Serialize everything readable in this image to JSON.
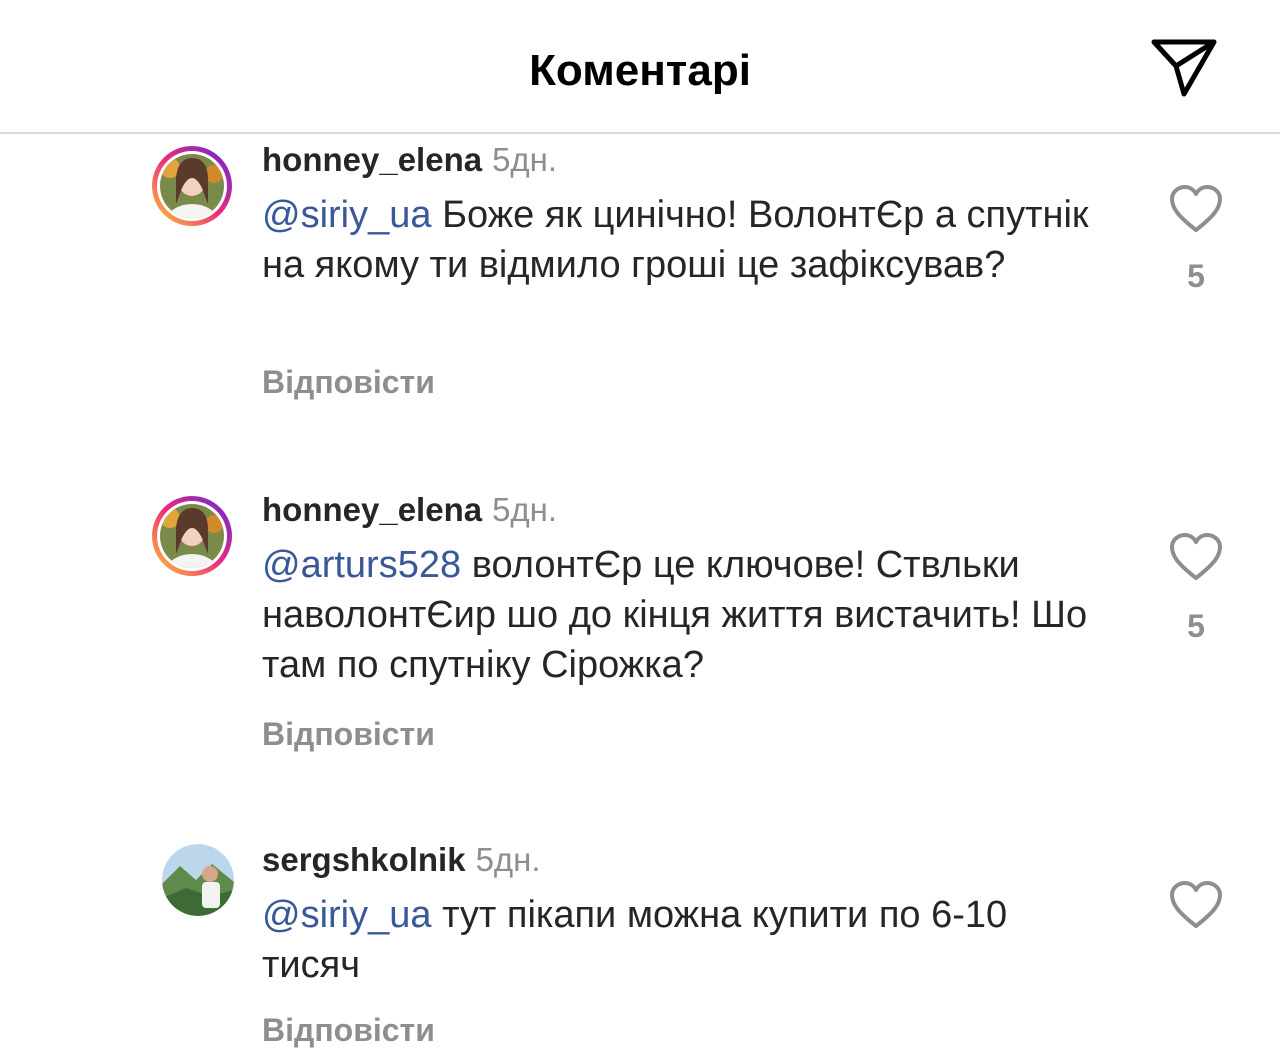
{
  "header": {
    "title": "Коментарі",
    "share_icon": "paper-plane-icon"
  },
  "comments": [
    {
      "username": "honney_elena",
      "time": "5дн.",
      "mention": "@siriy_ua",
      "body": "Боже як цинічно! ВолонтЄр а спутнік на якому ти відмило гроші це зафіксував?",
      "reply": "Відповісти",
      "likes": "5"
    },
    {
      "username": "honney_elena",
      "time": "5дн.",
      "mention": "@arturs528",
      "body": "волонтЄр це ключове! Ствльки наволонтЄир шо до кінця життя вистачить! Шо там по спутніку Сірожка?",
      "reply": "Відповісти",
      "likes": "5"
    },
    {
      "username": "sergshkolnik",
      "time": "5дн.",
      "mention": "@siriy_ua",
      "body": "тут пікапи можна купити по 6-10 тисяч",
      "reply": "Відповісти",
      "likes": ""
    }
  ],
  "colors": {
    "mention": "#385898",
    "muted": "#8e8e8e",
    "text": "#262626",
    "story_ring_start": "#f9ce34",
    "story_ring_mid": "#ee2a7b",
    "story_ring_end": "#6228d7"
  }
}
